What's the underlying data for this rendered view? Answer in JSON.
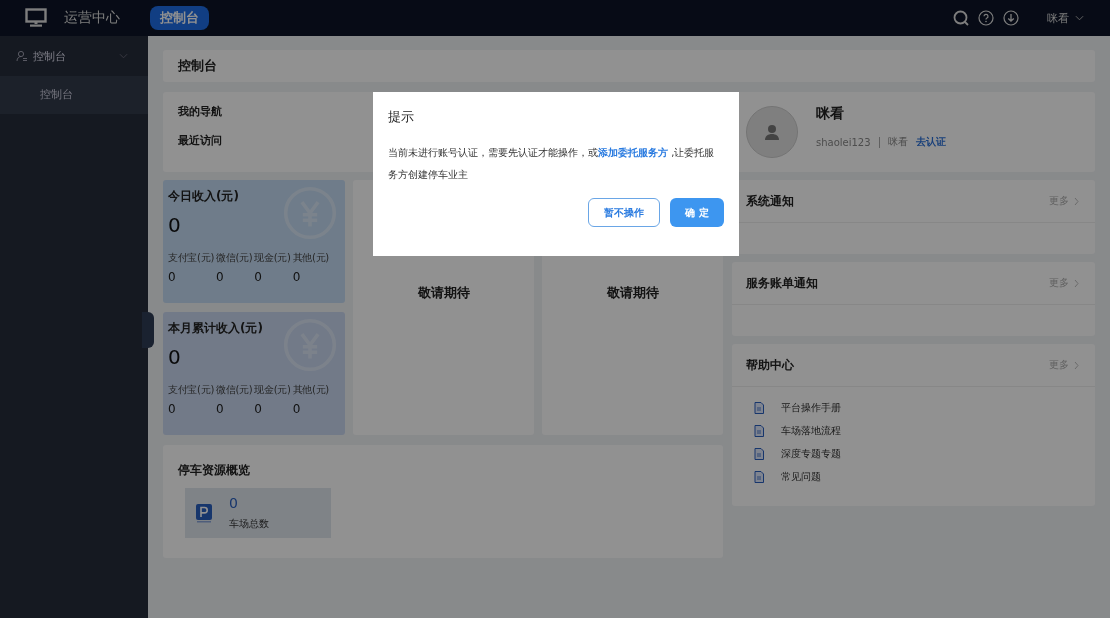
{
  "header": {
    "app_title": "运营中心",
    "tabs": [
      {
        "label": "控制台",
        "selected": true
      }
    ],
    "user": "咪看"
  },
  "sidebar": {
    "items": [
      {
        "label": "控制台",
        "expanded": true,
        "children": [
          {
            "label": "控制台",
            "selected": true
          }
        ]
      }
    ]
  },
  "page_title": "控制台",
  "nav": {
    "title": "我的导航",
    "recent": "最近访问"
  },
  "profile": {
    "name": "咪看",
    "account": "shaolei123",
    "nickname": "咪看",
    "verify_link": "去认证"
  },
  "income_cards": [
    {
      "title": "今日收入(元)",
      "amount": "0",
      "breakdown": [
        {
          "label": "支付宝(元)",
          "value": "0"
        },
        {
          "label": "微信(元)",
          "value": "0"
        },
        {
          "label": "现金(元)",
          "value": "0"
        },
        {
          "label": "其他(元)",
          "value": "0"
        }
      ]
    },
    {
      "title": "本月累计收入(元)",
      "amount": "0",
      "breakdown": [
        {
          "label": "支付宝(元)",
          "value": "0"
        },
        {
          "label": "微信(元)",
          "value": "0"
        },
        {
          "label": "现金(元)",
          "value": "0"
        },
        {
          "label": "其他(元)",
          "value": "0"
        }
      ]
    }
  ],
  "placeholder_cards": [
    {
      "text": "敬请期待"
    },
    {
      "text": "敬请期待"
    }
  ],
  "notices": [
    {
      "title": "系统通知",
      "more": "更多"
    },
    {
      "title": "服务账单通知",
      "more": "更多"
    }
  ],
  "help": {
    "title": "帮助中心",
    "more": "更多",
    "items": [
      "平台操作手册",
      "车场落地流程",
      "深度专题专题",
      "常见问题"
    ]
  },
  "parking": {
    "title": "停车资源概览",
    "count": "0",
    "label": "车场总数"
  },
  "dialog": {
    "title": "提示",
    "text_before": "当前未进行账号认证，需要先认证才能操作，或",
    "link": "添加委托服务方",
    "text_after": " ,让委托服务方创建停车业主",
    "cancel": "暂不操作",
    "ok": "确 定"
  }
}
